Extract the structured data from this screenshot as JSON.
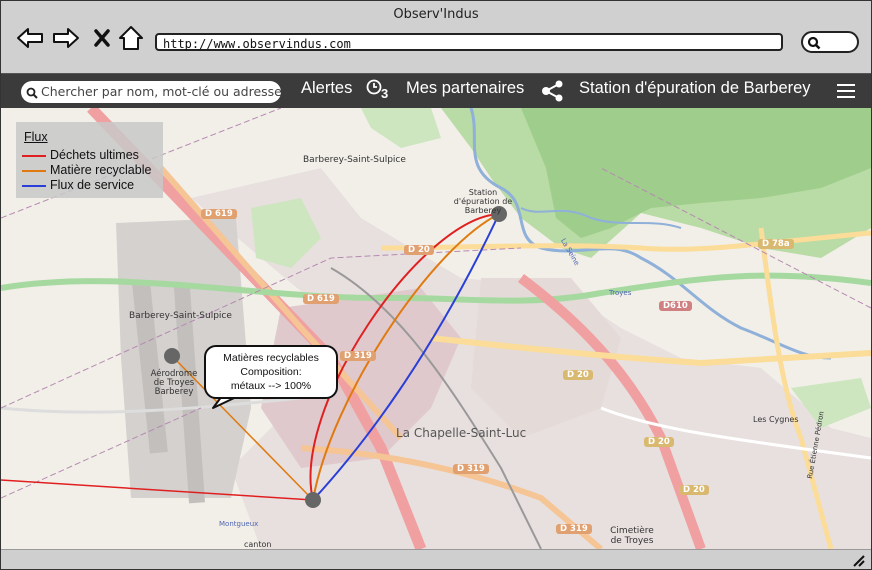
{
  "window": {
    "title": "Observ'Indus"
  },
  "browser": {
    "url": "http://www.observindus.com",
    "icons": [
      "back-arrow-icon",
      "forward-arrow-icon",
      "close-x-icon",
      "home-icon",
      "search-icon"
    ]
  },
  "menubar": {
    "search_placeholder": "Chercher par nom, mot-clé ou adresse",
    "alerts_label": "Alertes",
    "alerts_count": "3",
    "partners_label": "Mes partenaires",
    "station_label": "Station d'épuration de Barberey"
  },
  "legend": {
    "title": "Flux",
    "items": [
      {
        "label": "Déchets ultimes",
        "color": "#e02020"
      },
      {
        "label": "Matière recyclable",
        "color": "#e07a10"
      },
      {
        "label": "Flux de service",
        "color": "#2a3fd8"
      }
    ]
  },
  "callout": {
    "line1": "Matières recyclables",
    "line2": "Composition:",
    "line3": "métaux --> 100%"
  },
  "map": {
    "places": {
      "barberey_top": "Barberey-Saint-Sulpice",
      "barberey_left": "Barberey-Saint-Sulpice",
      "station": "Station d'épuration de Barberey",
      "aerodrome": "Aérodrome de Troyes Barberey",
      "chapelle": "La Chapelle-Saint-Luc",
      "cimetiere": "Cimetière de Troyes",
      "cygnes": "Les Cygnes",
      "montgueux": "Montgueux",
      "canton": "canton",
      "la_seine": "La Seine",
      "troyes": "Troyes",
      "etienne": "Rue Étienne Pédron"
    },
    "roads": [
      "D 619",
      "D 619",
      "D 20",
      "D 78a",
      "D610",
      "D 319",
      "D 20",
      "D 20",
      "D 319",
      "D 20",
      "D 319"
    ]
  },
  "colors": {
    "menubar": "#3b3b3b",
    "accent_red": "#e02020",
    "accent_orange": "#e07a10",
    "accent_blue": "#2a3fd8"
  }
}
